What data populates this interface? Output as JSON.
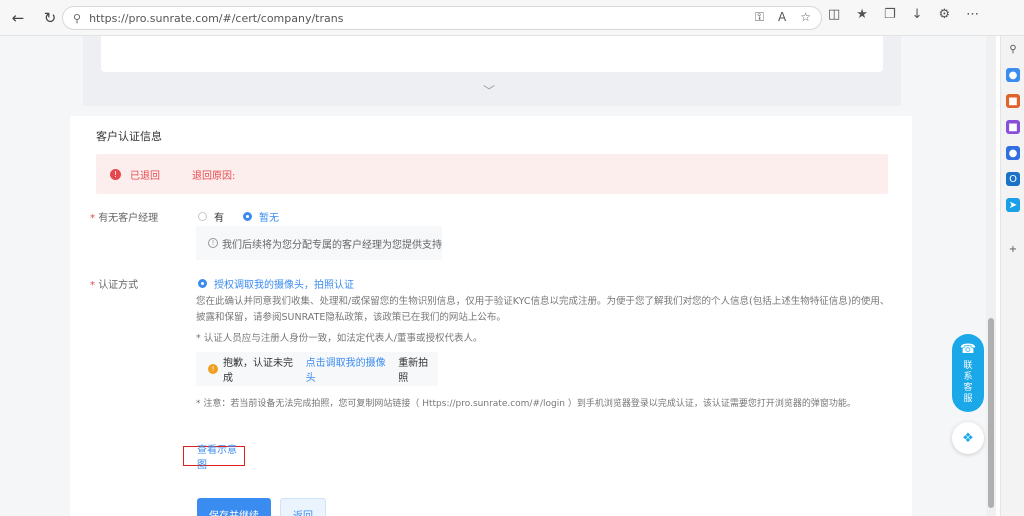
{
  "browser": {
    "url": "https://pro.sunrate.com/#/cert/company/trans"
  },
  "section": {
    "title": "客户认证信息"
  },
  "alert": {
    "status": "已退回",
    "reason_label": "退回原因:"
  },
  "manager": {
    "label": "有无客户经理",
    "option_yes": "有",
    "option_no": "暂无",
    "tip": "我们后续将为您分配专属的客户经理为您提供支持"
  },
  "auth": {
    "label": "认证方式",
    "option": "授权调取我的摄像头，拍照认证",
    "desc_line1": "您在此确认并同意我们收集、处理和/或保留您的生物识别信息，仅用于验证KYC信息以完成注册。为便于您了解我们对您的个人信息(包括上述生物特征信息)的使用、",
    "desc_line2": "披露和保留，请参阅SUNRATE隐私政策，该政策已在我们的网站上公布。",
    "note": "* 认证人员应与注册人身份一致，如法定代表人/董事或授权代表人。",
    "warn_prefix": "抱歉，认证未完成",
    "warn_link": "点击调取我的摄像头",
    "warn_suffix": "重新拍照",
    "notice": "* 注意：若当前设备无法完成拍照，您可复制网站链接（ Https://pro.sunrate.com/#/login ）到手机浏览器登录以完成认证，该认证需要您打开浏览器的弹窗功能。",
    "example_link": "查看示意图"
  },
  "actions": {
    "save": "保存并继续",
    "back": "返回"
  },
  "float": {
    "service": "联系客服"
  }
}
